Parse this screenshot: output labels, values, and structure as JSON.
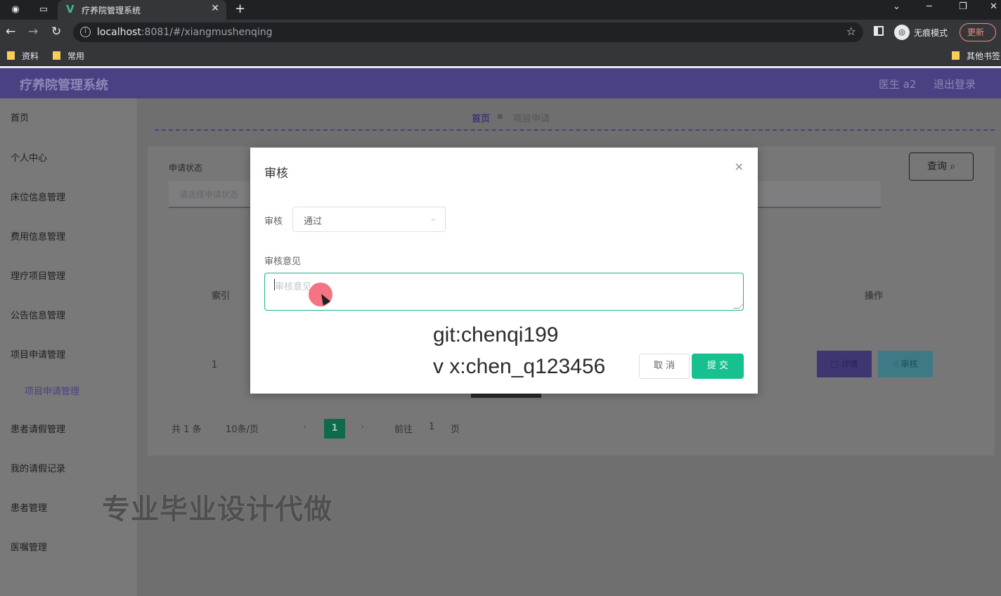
{
  "browser": {
    "tab_title": "疗养院管理系统",
    "tab_logo": "V",
    "url_host": "localhost",
    "url_rest": ":8081/#/xiangmushenqing",
    "incognito_label": "无痕模式",
    "update_label": "更新",
    "bookmarks": [
      "资料",
      "常用"
    ],
    "other_bookmarks": "其他书签"
  },
  "header": {
    "app_title": "疗养院管理系统",
    "user_label": "医生 a2",
    "logout_label": "退出登录"
  },
  "sidebar": {
    "items": [
      "首页",
      "个人中心",
      "床位信息管理",
      "费用信息管理",
      "理疗项目管理",
      "公告信息管理",
      "项目申请管理",
      "患者请假管理",
      "我的请假记录",
      "患者管理",
      "医嘱管理"
    ],
    "sub_item": "项目申请管理"
  },
  "breadcrumb": {
    "home": "首页",
    "current": "项目申请"
  },
  "filter": {
    "status_label": "申请状态",
    "status_placeholder": "请选择申请状态",
    "query_label": "查询"
  },
  "table": {
    "col_index": "索引",
    "col_actions": "操作",
    "row_index": "1",
    "detail_label": "详情",
    "audit_label": "审核"
  },
  "pagination": {
    "total": "共 1 条",
    "page_size": "10条/页",
    "current_page": "1",
    "goto_label": "前往",
    "goto_value": "1",
    "page_suffix": "页"
  },
  "dialog": {
    "title": "审核",
    "audit_label": "审核",
    "audit_value": "通过",
    "opinion_label": "审核意见",
    "opinion_placeholder": "审核意见",
    "cancel_label": "取 消",
    "submit_label": "提 交"
  },
  "watermark": {
    "line1": "git:chenqi199",
    "line2": "v x:chen_q123456",
    "banner": "专业毕业设计代做"
  },
  "colors": {
    "header_bg": "#4a4182",
    "primary_green": "#16c08f",
    "accent_purple": "#4a4182"
  }
}
